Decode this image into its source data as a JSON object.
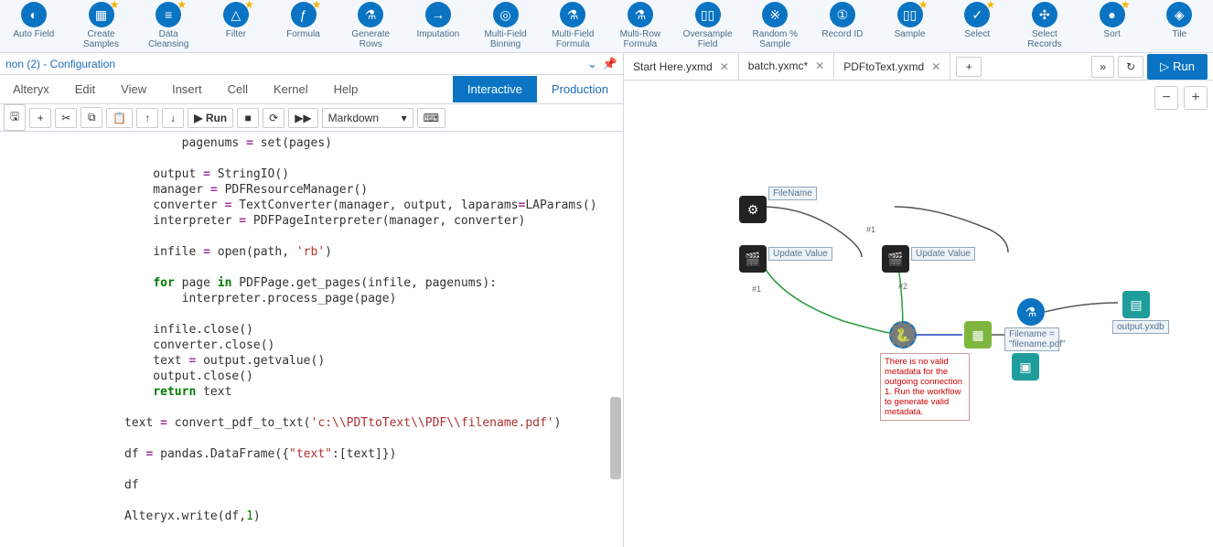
{
  "ribbon": [
    {
      "label": "Auto Field",
      "fav": false,
      "glyph": "◐"
    },
    {
      "label": "Create Samples",
      "fav": true,
      "glyph": "▦"
    },
    {
      "label": "Data Cleansing",
      "fav": true,
      "glyph": "≡"
    },
    {
      "label": "Filter",
      "fav": true,
      "glyph": "△"
    },
    {
      "label": "Formula",
      "fav": true,
      "glyph": "ƒ"
    },
    {
      "label": "Generate Rows",
      "fav": false,
      "glyph": "⚗"
    },
    {
      "label": "Imputation",
      "fav": false,
      "glyph": "→"
    },
    {
      "label": "Multi-Field Binning",
      "fav": false,
      "glyph": "◎"
    },
    {
      "label": "Multi-Field Formula",
      "fav": false,
      "glyph": "⚗"
    },
    {
      "label": "Multi-Row Formula",
      "fav": false,
      "glyph": "⚗"
    },
    {
      "label": "Oversample Field",
      "fav": false,
      "glyph": "▯▯"
    },
    {
      "label": "Random % Sample",
      "fav": false,
      "glyph": "※"
    },
    {
      "label": "Record ID",
      "fav": false,
      "glyph": "①"
    },
    {
      "label": "Sample",
      "fav": true,
      "glyph": "▯▯"
    },
    {
      "label": "Select",
      "fav": true,
      "glyph": "✓"
    },
    {
      "label": "Select Records",
      "fav": false,
      "glyph": "✣"
    },
    {
      "label": "Sort",
      "fav": true,
      "glyph": "●"
    },
    {
      "label": "Tile",
      "fav": false,
      "glyph": "◈"
    }
  ],
  "config": {
    "title": "non (2) - Configuration"
  },
  "jupyter": {
    "menus": [
      "Alteryx",
      "Edit",
      "View",
      "Insert",
      "Cell",
      "Kernel",
      "Help"
    ],
    "modes": {
      "interactive": "Interactive",
      "production": "Production"
    },
    "toolbar": {
      "save": "🖫",
      "add": "+",
      "cut": "✂",
      "copy": "⧉",
      "paste": "📋",
      "up": "↑",
      "down": "↓",
      "run": "▶ Run",
      "stop": "■",
      "restart": "⟳",
      "ff": "▶▶",
      "celltype": "Markdown",
      "keyboard": "⌨"
    }
  },
  "tabs": {
    "items": [
      {
        "label": "Start Here.yxmd",
        "active": false
      },
      {
        "label": "batch.yxmc*",
        "active": true
      },
      {
        "label": "PDFtoText.yxmd",
        "active": false
      }
    ],
    "run_label": "Run"
  },
  "zoom": {
    "minus": "−",
    "plus": "+"
  },
  "canvas": {
    "filename_label": "FileName",
    "update1": "Update Value",
    "update2": "Update Value",
    "formula_label": "Filename = \"filename.pdf\"",
    "output_label": "output.yxdb",
    "conn1": "#1",
    "conn2": "#2",
    "conn1b": "#1",
    "error": "There is no valid metadata for the outgoing connection 1.\nRun the workflow to generate valid metadata."
  },
  "code": {
    "l1": "        pagenums = set(pages)",
    "l2": "    output = StringIO()",
    "l3": "    manager = PDFResourceManager()",
    "l4": "    converter = TextConverter(manager, output, laparams=LAParams()",
    "l5": "    interpreter = PDFPageInterpreter(manager, converter)",
    "l6": "    infile = open(path, 'rb')",
    "l7a": "    for page in PDFPage.get_pages(infile, pagenums):",
    "l7b": "        interpreter.process_page(page)",
    "l8": "    infile.close()",
    "l9": "    converter.close()",
    "l10": "    text = output.getvalue()",
    "l11": "    output.close()",
    "l12": "    return text",
    "l13": "text = convert_pdf_to_txt('c:\\\\PDTtoText\\\\PDF\\\\filename.pdf')",
    "l14": "df = pandas.DataFrame({\"text\":[text]})",
    "l15": "df",
    "l16": "Alteryx.write(df,1)"
  }
}
